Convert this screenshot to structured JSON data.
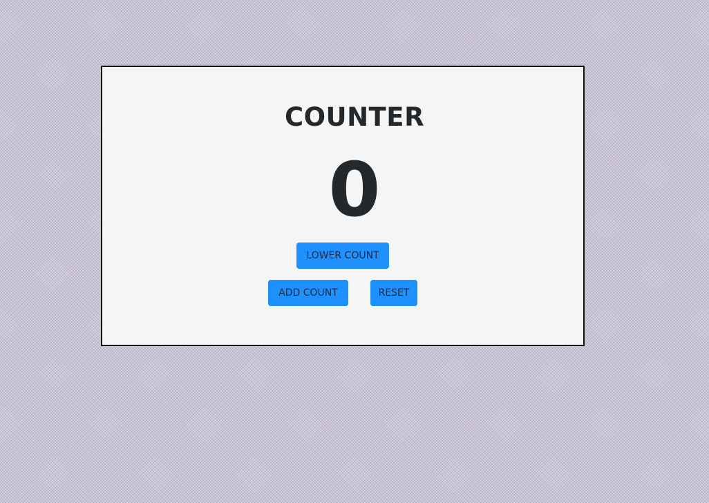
{
  "counter": {
    "title": "COUNTER",
    "value": "0"
  },
  "buttons": {
    "lower_label": "LOWER COUNT",
    "add_label": "ADD COUNT",
    "reset_label": "RESET"
  },
  "colors": {
    "button_bg": "#1e90ff",
    "card_bg": "#f5f5f5",
    "text": "#23282d"
  }
}
